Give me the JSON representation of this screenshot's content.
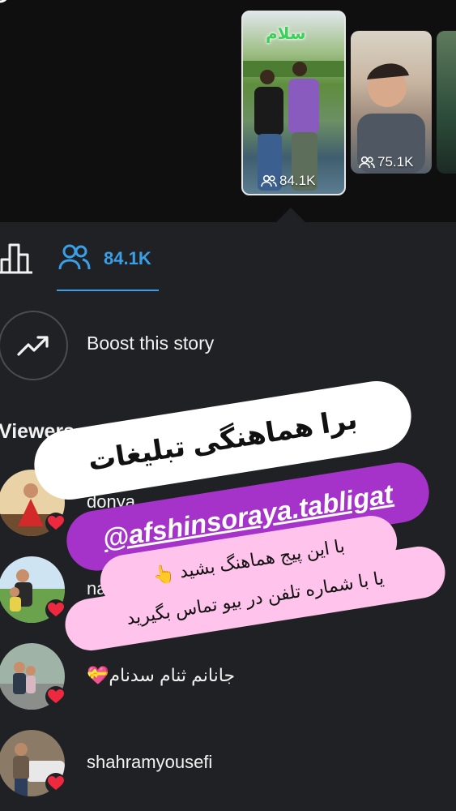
{
  "story_strip": {
    "thumbnails": [
      {
        "view_count": "84.1K",
        "overlay_text": "سلام"
      },
      {
        "view_count": "75.1K"
      },
      {
        "view_count": ""
      }
    ]
  },
  "tabs": {
    "insights_icon": "bar-chart-icon",
    "viewers_icon": "people-icon",
    "viewers_count": "84.1K"
  },
  "boost": {
    "label": "Boost this story",
    "icon": "trending-up-icon"
  },
  "viewers": {
    "heading": "Viewers",
    "list": [
      {
        "username": "donya",
        "liked": true
      },
      {
        "username": "naz",
        "liked": true
      },
      {
        "username": "جانانم ثنام سدنام",
        "emoji": "💝",
        "liked": true
      },
      {
        "username": "shahramyousefi",
        "liked": true
      }
    ]
  },
  "ad_overlays": {
    "line1": "برا هماهنگی تبلیغات",
    "line2": "@afshinsoraya.tabligat",
    "line3": "با این پیج هماهنگ بشید 👆",
    "line4": "یا با شماره تلفن در بیو تماس بگیرید"
  },
  "colors": {
    "background": "#1f2124",
    "accent_blue": "#3a9fe6",
    "heart_red": "#ed2940",
    "ad_purple": "#a532c9",
    "ad_pink": "#ffc3ec"
  }
}
